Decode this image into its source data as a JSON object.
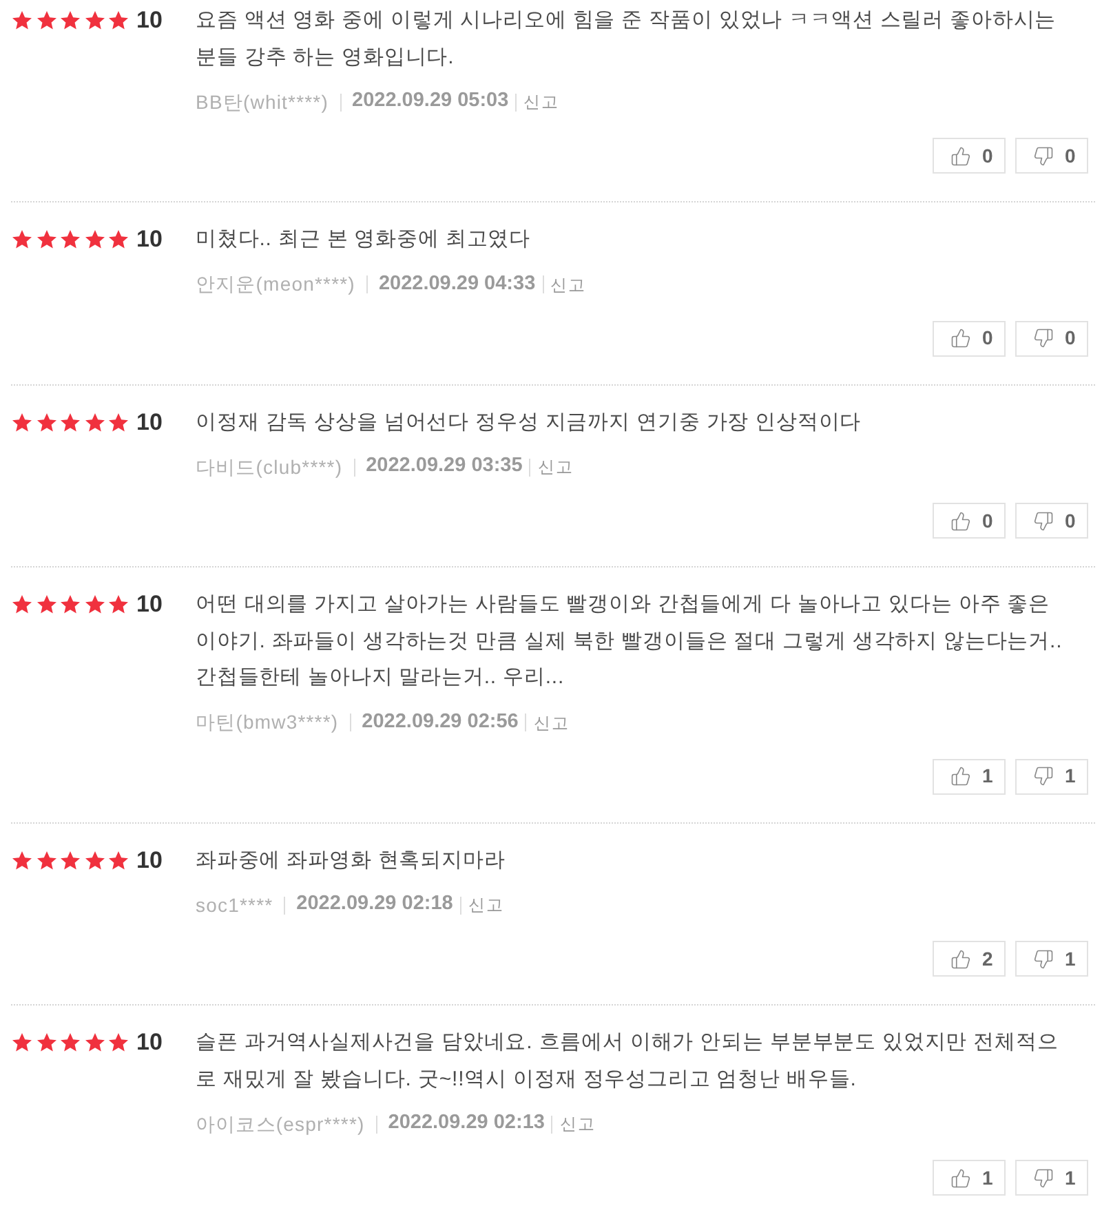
{
  "reviews": [
    {
      "stars": 5,
      "score": "10",
      "text": "요즘 액션 영화 중에 이렇게 시나리오에 힘을 준 작품이 있었나 ㅋㅋ액션 스릴러 좋아하시는 분들 강추 하는 영화입니다.",
      "user": "BB탄(whit****)",
      "date": "2022.09.29 05:03",
      "report": "신고",
      "likes": "0",
      "dislikes": "0"
    },
    {
      "stars": 5,
      "score": "10",
      "text": "미쳤다.. 최근 본 영화중에 최고였다",
      "user": "안지운(meon****)",
      "date": "2022.09.29 04:33",
      "report": "신고",
      "likes": "0",
      "dislikes": "0"
    },
    {
      "stars": 5,
      "score": "10",
      "text": "이정재 감독 상상을 넘어선다 정우성 지금까지 연기중 가장 인상적이다",
      "user": "다비드(club****)",
      "date": "2022.09.29 03:35",
      "report": "신고",
      "likes": "0",
      "dislikes": "0"
    },
    {
      "stars": 5,
      "score": "10",
      "text": "어떤 대의를 가지고 살아가는 사람들도 빨갱이와 간첩들에게 다 놀아나고 있다는 아주 좋은 이야기. 좌파들이 생각하는것 만큼 실제 북한 빨갱이들은 절대 그렇게 생각하지 않는다는거.. 간첩들한테 놀아나지 말라는거.. 우리...",
      "user": "마틴(bmw3****)",
      "date": "2022.09.29 02:56",
      "report": "신고",
      "likes": "1",
      "dislikes": "1"
    },
    {
      "stars": 5,
      "score": "10",
      "text": "좌파중에 좌파영화 현혹되지마라",
      "user": "soc1****",
      "date": "2022.09.29 02:18",
      "report": "신고",
      "likes": "2",
      "dislikes": "1"
    },
    {
      "stars": 5,
      "score": "10",
      "text": "슬픈 과거역사실제사건을 담았네요. 흐름에서 이해가 안되는 부분부분도 있었지만 전체적으로 재밌게 잘 봤습니다. 굿~!!역시 이정재 정우성그리고 엄청난 배우들.",
      "user": "아이코스(espr****)",
      "date": "2022.09.29 02:13",
      "report": "신고",
      "likes": "1",
      "dislikes": "1"
    }
  ]
}
